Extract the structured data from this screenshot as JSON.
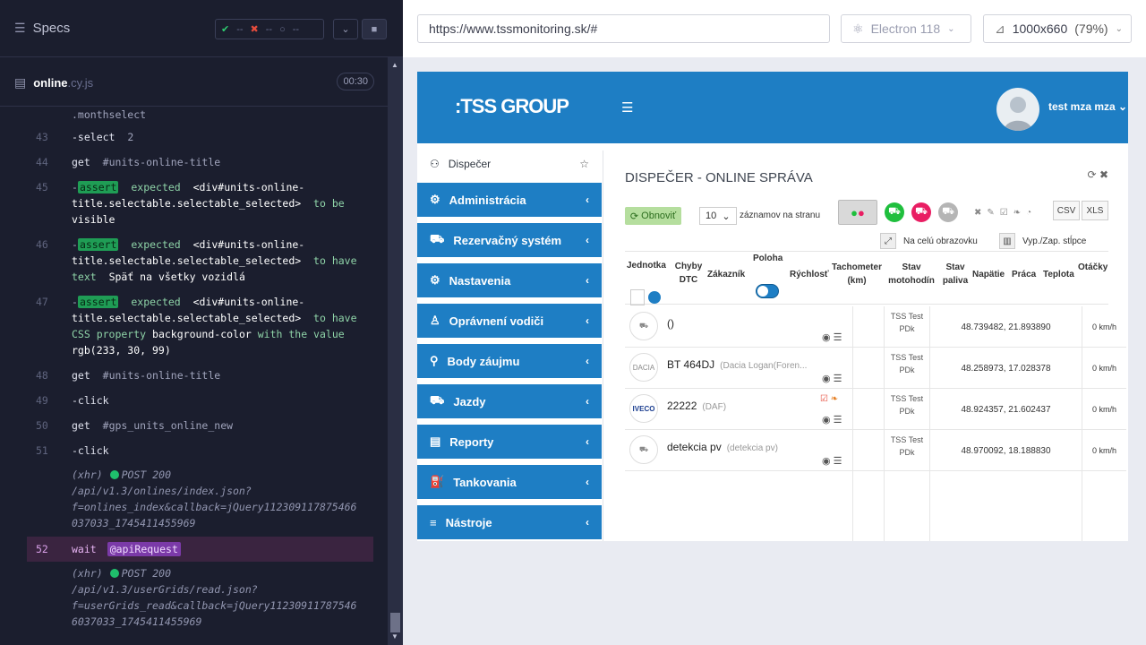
{
  "runner": {
    "title": "Specs",
    "stats": {
      "passed": "--",
      "failed": "--",
      "pending": "--"
    },
    "spec_name": "online",
    "spec_ext": ".cy.js",
    "duration": "00:30",
    "commands": [
      {
        "kind": "partial",
        "text": ".monthselect"
      },
      {
        "kind": "cmd",
        "num": "43",
        "name": "-select",
        "arg": "2"
      },
      {
        "kind": "cmd",
        "num": "44",
        "name": "get",
        "arg": "#units-online-title"
      },
      {
        "kind": "assert",
        "num": "45",
        "line1": "expected",
        "line1b": "<div#units-online-",
        "line2": "title.selectable.selectable_selected>",
        "line2b": "to be",
        "line3": "visible"
      },
      {
        "kind": "assert",
        "num": "46",
        "line1": "expected",
        "line1b": "<div#units-online-",
        "line2": "title.selectable.selectable_selected>",
        "line2b": "to have",
        "line3": "text",
        "line3b": "Späť na všetky vozidlá"
      },
      {
        "kind": "assert4",
        "num": "47",
        "line1": "expected",
        "line1b": "<div#units-online-",
        "line2": "title.selectable.selectable_selected>",
        "line2b": "to have",
        "line3": "CSS property",
        "line3b": "background-color",
        "line3c": "with the value",
        "line4": "rgb(233, 30, 99)"
      },
      {
        "kind": "cmd",
        "num": "48",
        "name": "get",
        "arg": "#units-online-title"
      },
      {
        "kind": "cmd",
        "num": "49",
        "name": "-click",
        "arg": ""
      },
      {
        "kind": "cmd",
        "num": "50",
        "name": "get",
        "arg": "#gps_units_online_new"
      },
      {
        "kind": "cmd",
        "num": "51",
        "name": "-click",
        "arg": ""
      }
    ],
    "assert_label": "assert",
    "xhr1": {
      "label": "(xhr)",
      "method": "POST 200",
      "l1": "/api/v1.3/onlines/index.json?",
      "l2": "f=onlines_index&callback=jQuery112309117875466",
      "l3": "037033_1745411455969"
    },
    "wait": {
      "num": "52",
      "name": "wait",
      "alias": "@apiRequest"
    },
    "xhr2": {
      "label": "(xhr)",
      "method": "POST 200",
      "l1": "/api/v1.3/userGrids/read.json?",
      "l2": "f=userGrids_read&callback=jQuery11230911787546",
      "l3": "6037033_1745411455969"
    }
  },
  "browser": {
    "url": "https://www.tssmonitoring.sk/#",
    "engine": "Electron 118",
    "viewport": "1000x660",
    "zoom": "(79%)"
  },
  "app": {
    "logo": ":TSS GROUP",
    "user": "test mza mza",
    "sidebar_first": "Dispečer",
    "sidebar": [
      "Administrácia",
      "Rezervačný systém",
      "Nastavenia",
      "Oprávnení vodiči",
      "Body záujmu",
      "Jazdy",
      "Reporty",
      "Tankovania",
      "Nástroje"
    ],
    "title": "DISPEČER - ONLINE SPRÁVA",
    "refresh": "Obnoviť",
    "per_page": "10",
    "per_page_label": "záznamov na stranu",
    "csv": "CSV",
    "xls": "XLS",
    "fullscreen": "Na celú obrazovku",
    "toggle_cols": "Vyp./Zap. stĺpce",
    "headers": [
      "Jednotka",
      "Chyby DTC",
      "Zákazník",
      "Poloha",
      "Rýchlosť",
      "Tachometer (km)",
      "Stav motohodín",
      "Stav paliva",
      "Napätie",
      "Práca",
      "Teplota",
      "Otáčky motora"
    ],
    "rows": [
      {
        "name": "()",
        "sub": "",
        "customer": "TSS Test PDk",
        "gps": "48.739482, 21.893890",
        "speed": "0 km/h"
      },
      {
        "name": "BT 464DJ",
        "sub": "(Dacia Logan(Foren...",
        "customer": "TSS Test PDk",
        "gps": "48.258973, 17.028378",
        "speed": "0 km/h"
      },
      {
        "name": "22222",
        "sub": "(DAF)",
        "customer": "TSS Test PDk",
        "gps": "48.924357, 21.602437",
        "speed": "0 km/h"
      },
      {
        "name": "detekcia pv",
        "sub": "(detekcia pv)",
        "customer": "TSS Test PDk",
        "gps": "48.970092, 18.188830",
        "speed": "0 km/h"
      }
    ],
    "brand_iveco": "IVECO",
    "brand_dacia": "DACIA",
    "colors": {
      "header": "#1e7ec4",
      "runner_bg": "#1b1e2e",
      "assert": "#1f9d55",
      "alias": "#7b3aa8"
    }
  }
}
